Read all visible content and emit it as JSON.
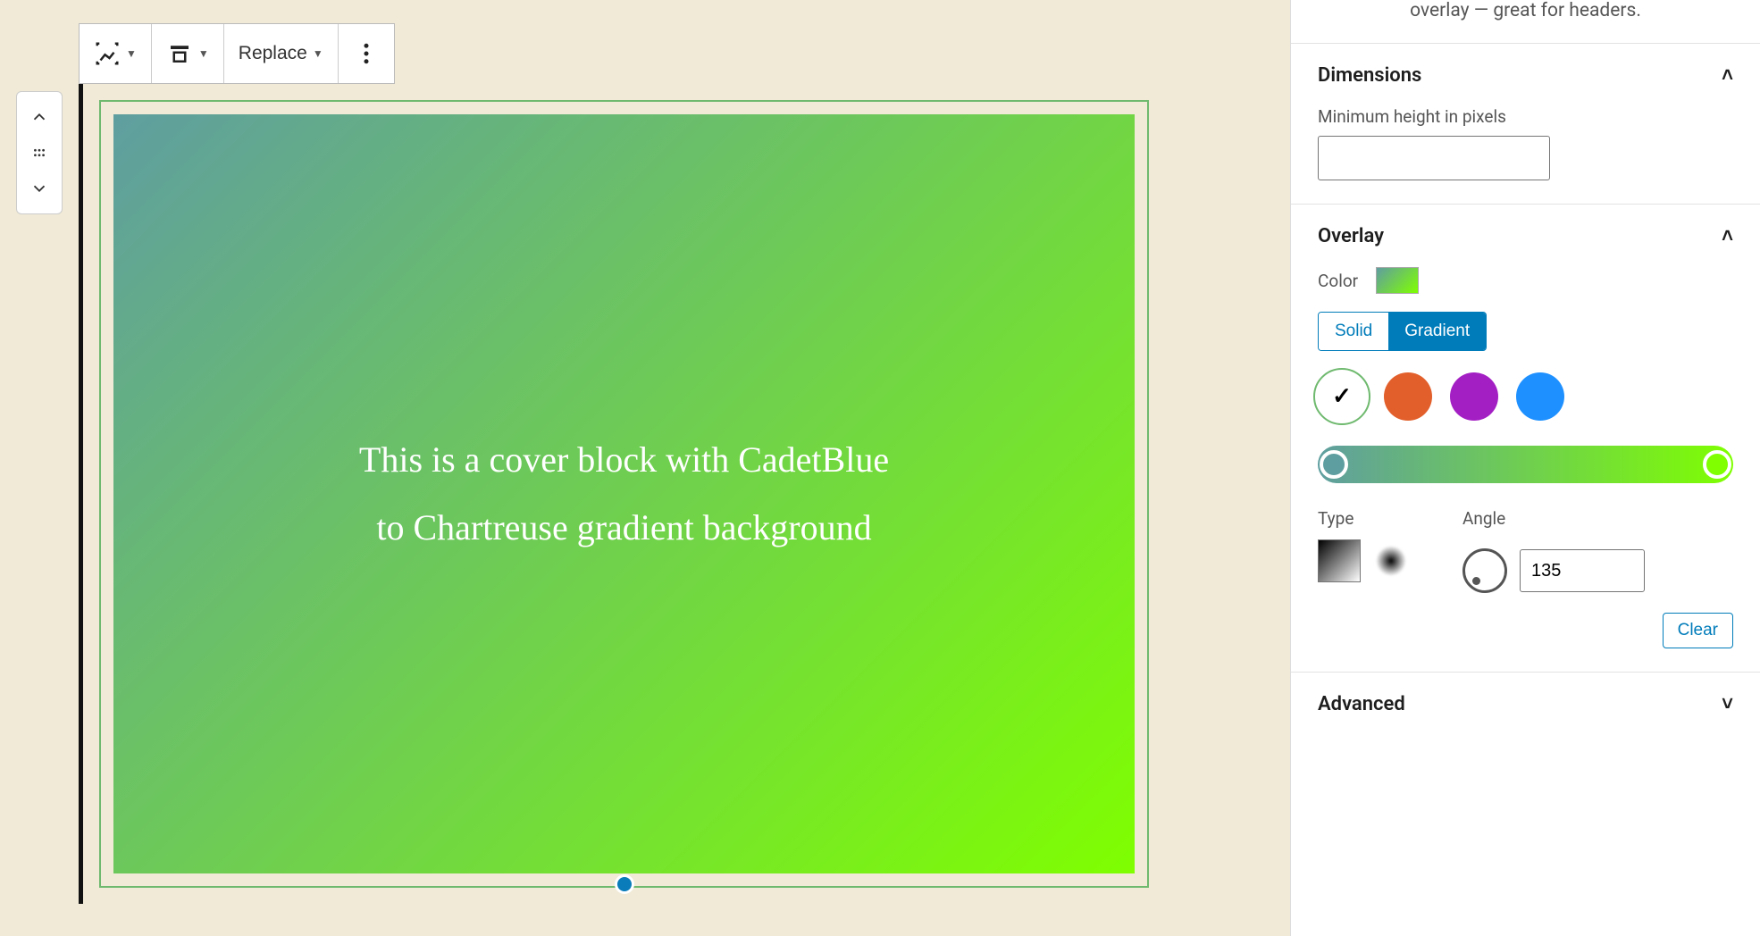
{
  "description_snippet": "overlay — great for headers.",
  "toolbar": {
    "replace_label": "Replace"
  },
  "cover": {
    "text": "This is a cover block with CadetBlue to Chartreuse gradient background"
  },
  "sidebar": {
    "dimensions": {
      "title": "Dimensions",
      "min_height_label": "Minimum height in pixels",
      "min_height_value": ""
    },
    "overlay": {
      "title": "Overlay",
      "color_label": "Color",
      "solid_label": "Solid",
      "gradient_label": "Gradient",
      "active_mode": "Gradient",
      "preset_swatches": [
        {
          "color": "#ffffff",
          "selected": true
        },
        {
          "color": "#e25f2b",
          "selected": false
        },
        {
          "color": "#a31fc4",
          "selected": false
        },
        {
          "color": "#1e90ff",
          "selected": false
        }
      ],
      "gradient_start": "#5f9ea0",
      "gradient_end": "#7fff00",
      "type_label": "Type",
      "angle_label": "Angle",
      "angle_value": "135",
      "clear_label": "Clear"
    },
    "advanced": {
      "title": "Advanced"
    }
  }
}
